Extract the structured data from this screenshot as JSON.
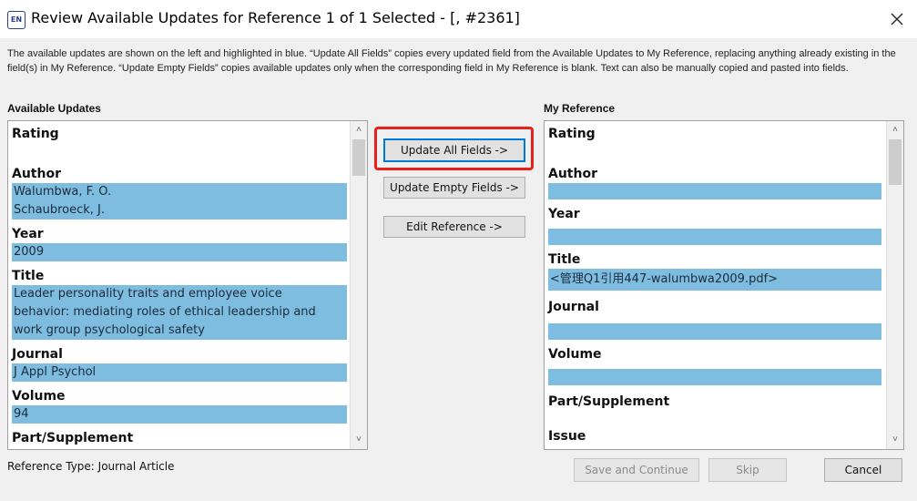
{
  "window": {
    "icon_text": "EN",
    "title": "Review Available Updates for Reference 1 of 1 Selected - [,  #2361]"
  },
  "description": "The available updates are shown on the left and highlighted in blue. “Update All Fields” copies every updated field from the Available Updates to My Reference, replacing anything already existing in the field(s) in My Reference. “Update Empty Fields” copies available updates only when the corresponding field in My Reference is blank. Text can also be manually copied and pasted into fields.",
  "available": {
    "label": "Available Updates",
    "rating_label": "Rating",
    "author_label": "Author",
    "author_lines": [
      "Walumbwa, F. O.",
      "Schaubroeck, J."
    ],
    "year_label": "Year",
    "year_value": "2009",
    "title_label": "Title",
    "title_lines": [
      "Leader personality traits and employee voice",
      "behavior: mediating roles of ethical leadership and",
      "work group psychological safety"
    ],
    "journal_label": "Journal",
    "journal_value": "J Appl Psychol",
    "volume_label": "Volume",
    "volume_value": "94",
    "partial_label": "Part/Supplement"
  },
  "buttons": {
    "update_all": "Update All Fields ->",
    "update_empty": "Update Empty Fields ->",
    "edit_reference": "Edit Reference ->",
    "save_continue": "Save and Continue",
    "skip": "Skip",
    "cancel": "Cancel"
  },
  "my_reference": {
    "label": "My Reference",
    "rating_label": "Rating",
    "author_label": "Author",
    "year_label": "Year",
    "title_label": "Title",
    "title_value": "<管理Q1引用447-walumbwa2009.pdf>",
    "journal_label": "Journal",
    "volume_label": "Volume",
    "part_label": "Part/Supplement",
    "issue_label": "Issue"
  },
  "footer": {
    "reference_type": "Reference Type: Journal Article"
  },
  "icons": {
    "close": "close-icon",
    "scroll_up": "chevron-up-icon",
    "scroll_down": "chevron-down-icon"
  },
  "colors": {
    "highlight_blue": "#7fbde0",
    "annotation_red": "#e8201a",
    "focus_blue": "#0078d7"
  }
}
